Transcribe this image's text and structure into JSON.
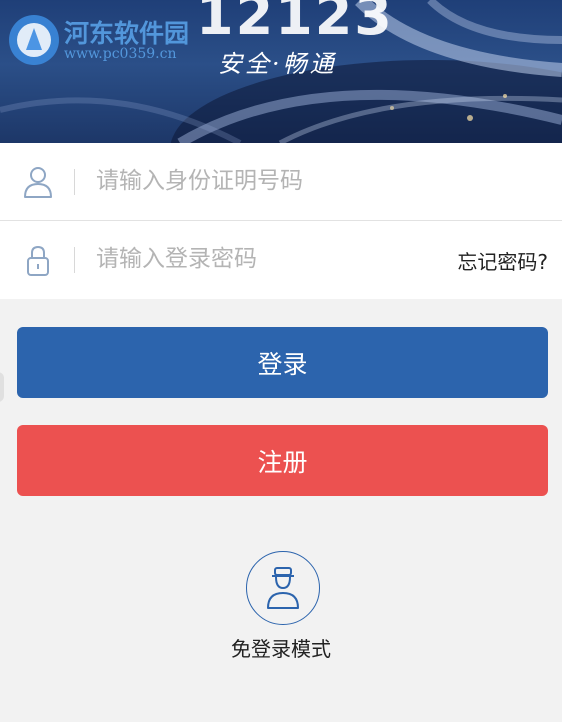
{
  "header": {
    "app_title": "12123",
    "slogan": "安全·畅通",
    "watermark_name": "河东软件园",
    "watermark_url": "www.pc0359.cn"
  },
  "login_form": {
    "id_placeholder": "请输入身份证明号码",
    "password_placeholder": "请输入登录密码",
    "forgot_password": "忘记密码?"
  },
  "buttons": {
    "login": "登录",
    "register": "注册"
  },
  "guest": {
    "label": "免登录模式"
  },
  "colors": {
    "primary": "#2c64ad",
    "danger": "#ec5150",
    "background": "#f2f2f2"
  },
  "icons": {
    "id_field": "user-icon",
    "password_field": "lock-icon",
    "guest": "officer-icon"
  }
}
